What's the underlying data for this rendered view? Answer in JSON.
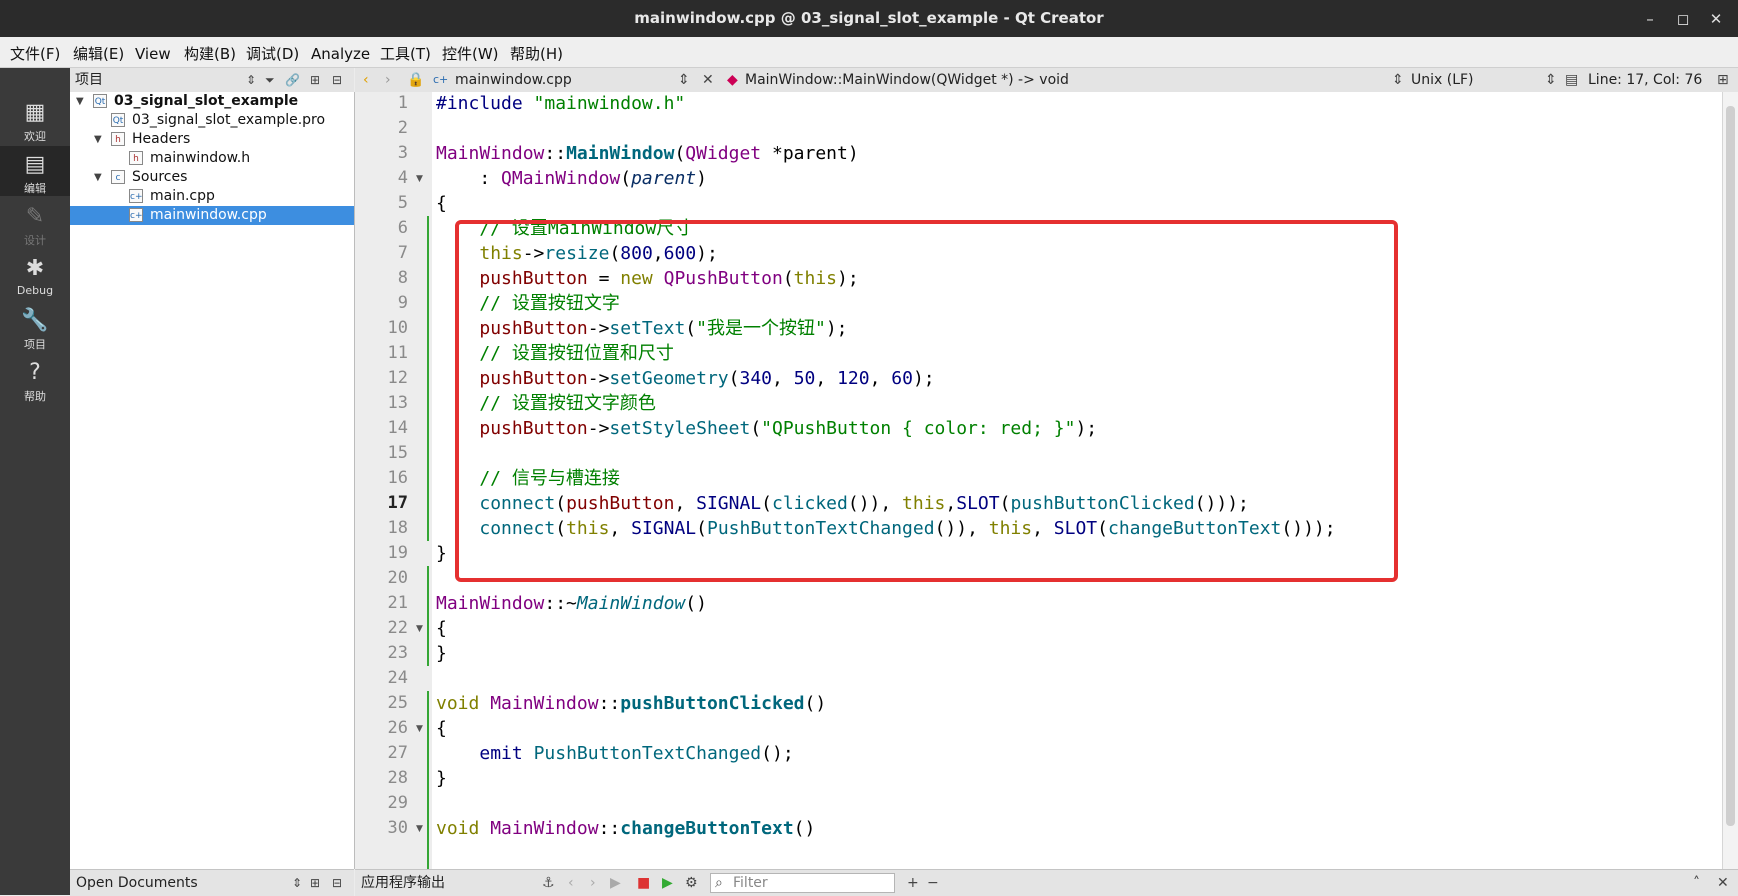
{
  "window": {
    "title": "mainwindow.cpp @ 03_signal_slot_example - Qt Creator",
    "controls": [
      "–",
      "◻",
      "✕"
    ]
  },
  "menu": [
    "文件(F)",
    "编辑(E)",
    "View",
    "构建(B)",
    "调试(D)",
    "Analyze",
    "工具(T)",
    "控件(W)",
    "帮助(H)"
  ],
  "modes": [
    {
      "label": "欢迎",
      "icon": "▦"
    },
    {
      "label": "编辑",
      "icon": "▤"
    },
    {
      "label": "设计",
      "icon": "✎"
    },
    {
      "label": "Debug",
      "icon": "✱"
    },
    {
      "label": "项目",
      "icon": "🔧"
    },
    {
      "label": "帮助",
      "icon": "?"
    }
  ],
  "project_panel": {
    "title": "项目",
    "tree": [
      {
        "label": "03_signal_slot_example",
        "bold": true
      },
      {
        "label": "03_signal_slot_example.pro"
      },
      {
        "label": "Headers"
      },
      {
        "label": "mainwindow.h"
      },
      {
        "label": "Sources"
      },
      {
        "label": "main.cpp"
      },
      {
        "label": "mainwindow.cpp"
      }
    ],
    "open_documents": "Open Documents"
  },
  "editor": {
    "file": "mainwindow.cpp",
    "symbol": "MainWindow::MainWindow(QWidget *) -> void",
    "line_endings": "Unix (LF)",
    "position": "Line: 17, Col: 76",
    "line_numbers": [
      "1",
      "2",
      "3",
      "4",
      "5",
      "6",
      "7",
      "8",
      "9",
      "10",
      "11",
      "12",
      "13",
      "14",
      "15",
      "16",
      "17",
      "18",
      "19",
      "20",
      "21",
      "22",
      "23",
      "24",
      "25",
      "26",
      "27",
      "28",
      "29",
      "30"
    ],
    "current_line": "17",
    "code": {
      "l1a": "#include ",
      "l1b": "\"mainwindow.h\"",
      "l3a": "MainWindow",
      "l3b": "::",
      "l3c": "MainWindow",
      "l3d": "(",
      "l3e": "QWidget",
      "l3f": " *",
      "l3g": "parent",
      "l3h": ")",
      "l4a": "    : ",
      "l4b": "QMainWindow",
      "l4c": "(",
      "l4d": "parent",
      "l4e": ")",
      "l5": "{",
      "l6": "    // 设置MainWindow尺寸",
      "l7a": "    ",
      "l7b": "this",
      "l7c": "->",
      "l7d": "resize",
      "l7e": "(",
      "l7f": "800",
      "l7g": ",",
      "l7h": "600",
      "l7i": ");",
      "l8a": "    ",
      "l8b": "pushButton",
      "l8c": " = ",
      "l8d": "new",
      "l8e": " ",
      "l8f": "QPushButton",
      "l8g": "(",
      "l8h": "this",
      "l8i": ");",
      "l9": "    // 设置按钮文字",
      "l10a": "    ",
      "l10b": "pushButton",
      "l10c": "->",
      "l10d": "setText",
      "l10e": "(",
      "l10f": "\"我是一个按钮\"",
      "l10g": ");",
      "l11": "    // 设置按钮位置和尺寸",
      "l12a": "    ",
      "l12b": "pushButton",
      "l12c": "->",
      "l12d": "setGeometry",
      "l12e": "(",
      "l12f": "340",
      "l12g": ", ",
      "l12h": "50",
      "l12i": ", ",
      "l12j": "120",
      "l12k": ", ",
      "l12l": "60",
      "l12m": ");",
      "l13": "    // 设置按钮文字颜色",
      "l14a": "    ",
      "l14b": "pushButton",
      "l14c": "->",
      "l14d": "setStyleSheet",
      "l14e": "(",
      "l14f": "\"QPushButton { color: red; }\"",
      "l14g": ");",
      "l16": "    // 信号与槽连接",
      "l17a": "    ",
      "l17b": "connect",
      "l17c": "(",
      "l17d": "pushButton",
      "l17e": ", ",
      "l17f": "SIGNAL",
      "l17g": "(",
      "l17h": "clicked",
      "l17i": "()), ",
      "l17j": "this",
      "l17k": ",",
      "l17l": "SLOT",
      "l17m": "(",
      "l17n": "pushButtonClicked",
      "l17o": "()));",
      "l18a": "    ",
      "l18b": "connect",
      "l18c": "(",
      "l18d": "this",
      "l18e": ", ",
      "l18f": "SIGNAL",
      "l18g": "(",
      "l18h": "PushButtonTextChanged",
      "l18i": "()), ",
      "l18j": "this",
      "l18k": ", ",
      "l18l": "SLOT",
      "l18m": "(",
      "l18n": "changeButtonText",
      "l18o": "()));",
      "l19": "}",
      "l21a": "MainWindow",
      "l21b": "::~",
      "l21c": "MainWindow",
      "l21d": "()",
      "l22": "{",
      "l23": "}",
      "l25a": "void",
      "l25b": " ",
      "l25c": "MainWindow",
      "l25d": "::",
      "l25e": "pushButtonClicked",
      "l25f": "()",
      "l26": "{",
      "l27a": "    ",
      "l27b": "emit",
      "l27c": " ",
      "l27d": "PushButtonTextChanged",
      "l27e": "();",
      "l28": "}",
      "l30a": "void",
      "l30b": " ",
      "l30c": "MainWindow",
      "l30d": "::",
      "l30e": "changeButtonText",
      "l30f": "()"
    }
  },
  "output_panel": {
    "title": "应用程序输出",
    "filter_placeholder": "Filter"
  },
  "colors": {
    "highlight_box": "#e53030",
    "selection": "#3d8ee0"
  }
}
